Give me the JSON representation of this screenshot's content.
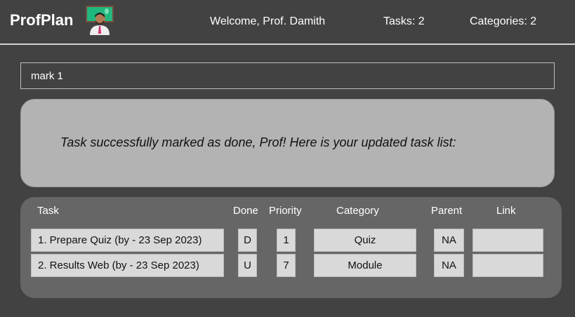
{
  "header": {
    "brand": "ProfPlan",
    "welcome": "Welcome, Prof. Damith",
    "tasks": "Tasks: 2",
    "categories": "Categories: 2"
  },
  "command": {
    "value": "mark 1"
  },
  "result": {
    "message": "Task successfully marked as done, Prof! Here is your updated task list:"
  },
  "table": {
    "headers": {
      "task": "Task",
      "done": "Done",
      "priority": "Priority",
      "category": "Category",
      "parent": "Parent",
      "link": "Link"
    },
    "rows": [
      {
        "task": "1. Prepare Quiz (by - 23 Sep 2023)",
        "done": "D",
        "priority": "1",
        "category": "Quiz",
        "parent": "NA",
        "link": ""
      },
      {
        "task": "2. Results Web (by - 23 Sep 2023)",
        "done": "U",
        "priority": "7",
        "category": "Module",
        "parent": "NA",
        "link": ""
      }
    ]
  }
}
